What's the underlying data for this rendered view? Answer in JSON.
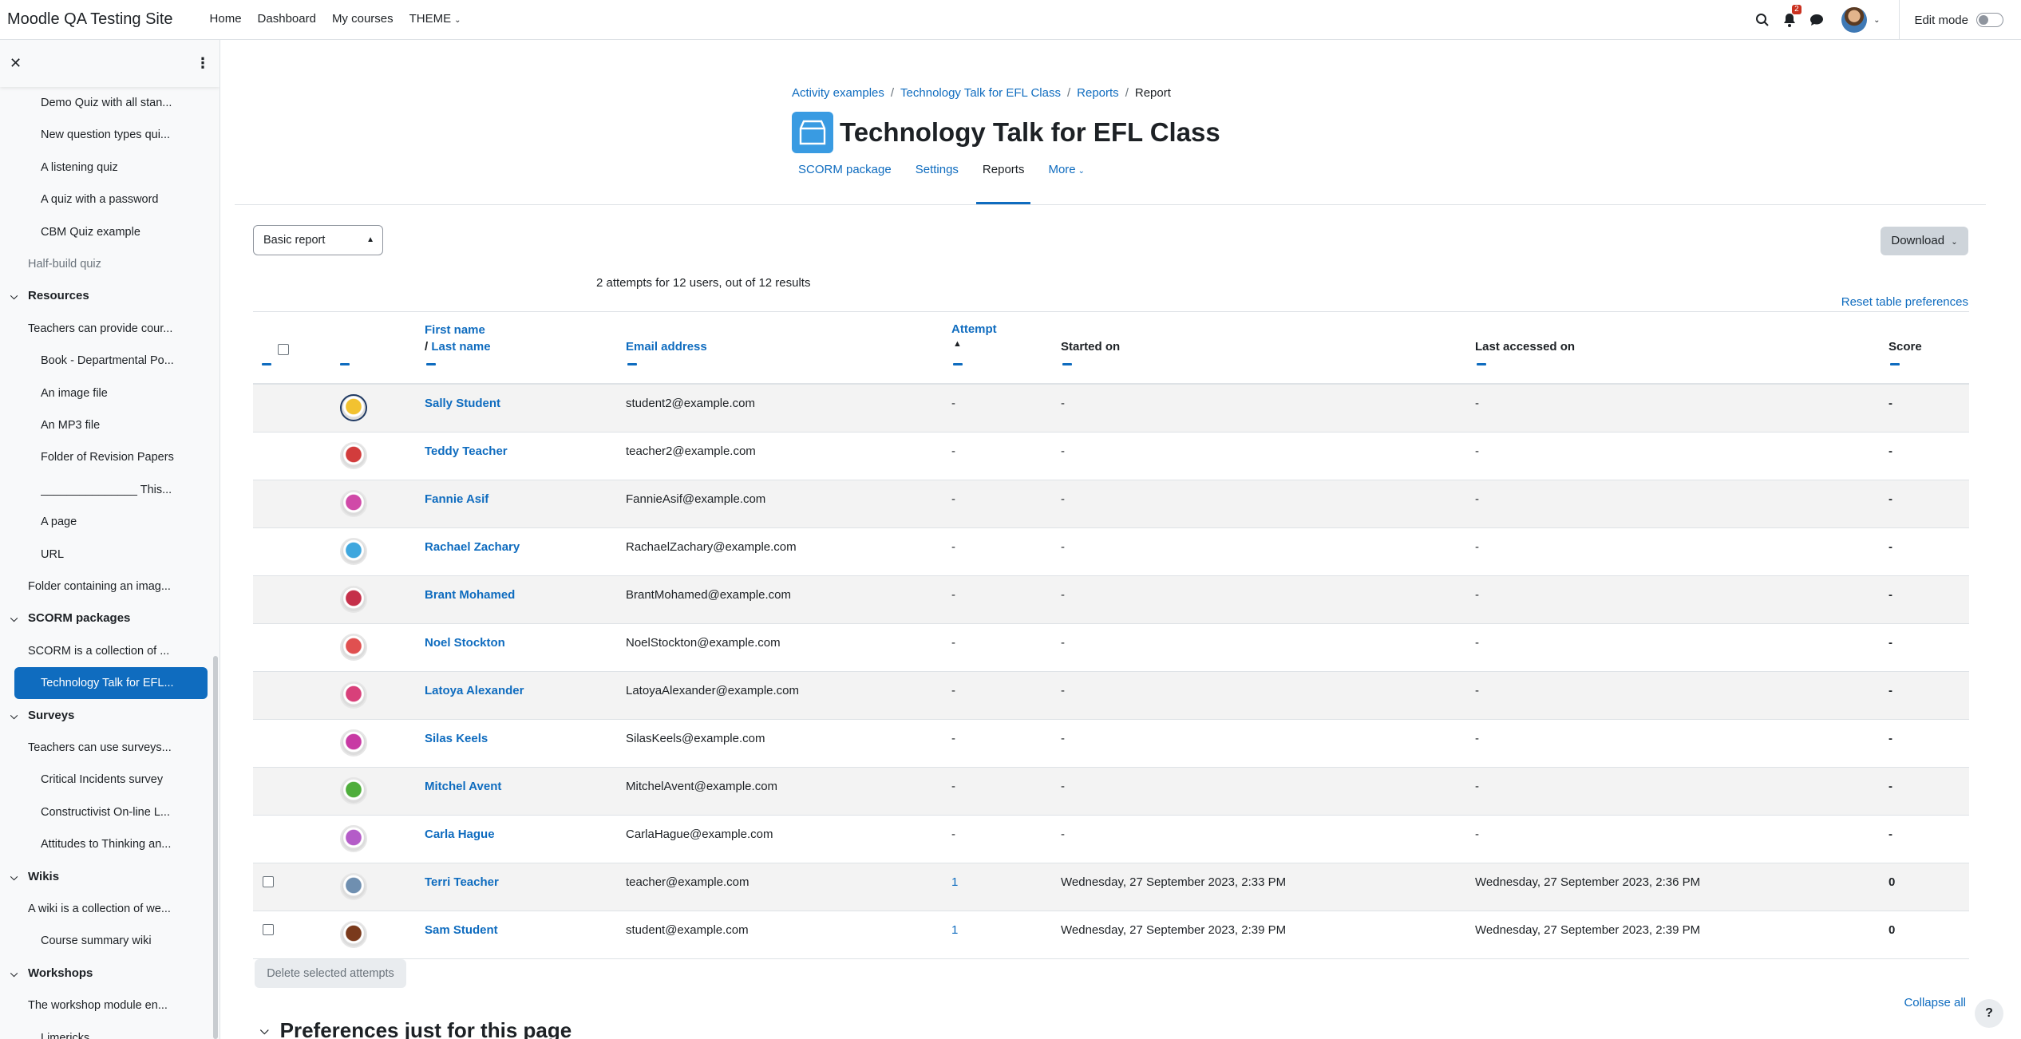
{
  "navbar": {
    "brand": "Moodle QA Testing Site",
    "items": [
      {
        "label": "Home"
      },
      {
        "label": "Dashboard"
      },
      {
        "label": "My courses"
      },
      {
        "label": "THEME"
      }
    ],
    "notifications_count": "2",
    "edit_mode_label": "Edit mode"
  },
  "drawer": {
    "items": [
      {
        "label": "Demo Quiz with all stan...",
        "level": "l2"
      },
      {
        "label": "New question types qui...",
        "level": "l2"
      },
      {
        "label": "A listening quiz",
        "level": "l2"
      },
      {
        "label": "A quiz with a password",
        "level": "l2"
      },
      {
        "label": "CBM Quiz example",
        "level": "l2"
      },
      {
        "label": "Half-build quiz",
        "level": "l1"
      },
      {
        "label": "Resources",
        "level": "section"
      },
      {
        "label": "Teachers can provide cour...",
        "level": "l1"
      },
      {
        "label": "Book - Departmental Po...",
        "level": "l2"
      },
      {
        "label": "An image file",
        "level": "l2"
      },
      {
        "label": "An MP3 file",
        "level": "l2"
      },
      {
        "label": "Folder of Revision Papers",
        "level": "l2"
      },
      {
        "label": "_______________ This...",
        "level": "l2"
      },
      {
        "label": "A page",
        "level": "l2"
      },
      {
        "label": "URL",
        "level": "l2"
      },
      {
        "label": "Folder containing an imag...",
        "level": "l1"
      },
      {
        "label": "SCORM packages",
        "level": "section"
      },
      {
        "label": "SCORM is a collection of ...",
        "level": "l1"
      },
      {
        "label": "Technology Talk for EFL...",
        "level": "active"
      },
      {
        "label": "Surveys",
        "level": "section"
      },
      {
        "label": "Teachers can use surveys...",
        "level": "l1"
      },
      {
        "label": "Critical Incidents survey",
        "level": "l2"
      },
      {
        "label": "Constructivist On-line L...",
        "level": "l2"
      },
      {
        "label": "Attitudes to Thinking an...",
        "level": "l2"
      },
      {
        "label": "Wikis",
        "level": "section"
      },
      {
        "label": "A wiki is a collection of we...",
        "level": "l1"
      },
      {
        "label": "Course summary wiki",
        "level": "l2"
      },
      {
        "label": "Workshops",
        "level": "section"
      },
      {
        "label": "The workshop module en...",
        "level": "l1"
      },
      {
        "label": "Limericks",
        "level": "l2"
      }
    ]
  },
  "breadcrumb": {
    "items": [
      "Activity examples",
      "Technology Talk for EFL Class",
      "Reports"
    ],
    "current": "Report"
  },
  "page": {
    "title": "Technology Talk for EFL Class",
    "tabs": [
      {
        "label": "SCORM package"
      },
      {
        "label": "Settings"
      },
      {
        "label": "Reports"
      },
      {
        "label": "More"
      }
    ],
    "report_select": "Basic report",
    "download_label": "Download",
    "results_text": "2 attempts for 12 users, out of 12 results",
    "reset_label": "Reset table preferences",
    "delete_label": "Delete selected attempts",
    "collapse_all": "Collapse all",
    "prefs_heading": "Preferences just for this page",
    "help": "?"
  },
  "table": {
    "headers": {
      "first_name": "First name",
      "slash": "/",
      "last_name": "Last name",
      "email": "Email address",
      "attempt": "Attempt",
      "started": "Started on",
      "last_accessed": "Last accessed on",
      "score": "Score"
    },
    "rows": [
      {
        "name": "Sally Student",
        "email": "student2@example.com",
        "attempt": "-",
        "started": "-",
        "last": "-",
        "score": "-",
        "checkbox": false,
        "color": "#f2c230"
      },
      {
        "name": "Teddy Teacher",
        "email": "teacher2@example.com",
        "attempt": "-",
        "started": "-",
        "last": "-",
        "score": "-",
        "checkbox": false,
        "color": "#d23c3c"
      },
      {
        "name": "Fannie Asif",
        "email": "FannieAsif@example.com",
        "attempt": "-",
        "started": "-",
        "last": "-",
        "score": "-",
        "checkbox": false,
        "color": "#d04aa8"
      },
      {
        "name": "Rachael Zachary",
        "email": "RachaelZachary@example.com",
        "attempt": "-",
        "started": "-",
        "last": "-",
        "score": "-",
        "checkbox": false,
        "color": "#3fa7de"
      },
      {
        "name": "Brant Mohamed",
        "email": "BrantMohamed@example.com",
        "attempt": "-",
        "started": "-",
        "last": "-",
        "score": "-",
        "checkbox": false,
        "color": "#c5304a"
      },
      {
        "name": "Noel Stockton",
        "email": "NoelStockton@example.com",
        "attempt": "-",
        "started": "-",
        "last": "-",
        "score": "-",
        "checkbox": false,
        "color": "#e05050"
      },
      {
        "name": "Latoya Alexander",
        "email": "LatoyaAlexander@example.com",
        "attempt": "-",
        "started": "-",
        "last": "-",
        "score": "-",
        "checkbox": false,
        "color": "#d8407a"
      },
      {
        "name": "Silas Keels",
        "email": "SilasKeels@example.com",
        "attempt": "-",
        "started": "-",
        "last": "-",
        "score": "-",
        "checkbox": false,
        "color": "#c83aa4"
      },
      {
        "name": "Mitchel Avent",
        "email": "MitchelAvent@example.com",
        "attempt": "-",
        "started": "-",
        "last": "-",
        "score": "-",
        "checkbox": false,
        "color": "#4fae3c"
      },
      {
        "name": "Carla Hague",
        "email": "CarlaHague@example.com",
        "attempt": "-",
        "started": "-",
        "last": "-",
        "score": "-",
        "checkbox": false,
        "color": "#b45cc8"
      },
      {
        "name": "Terri Teacher",
        "email": "teacher@example.com",
        "attempt": "1",
        "started": "Wednesday, 27 September 2023, 2:33 PM",
        "last": "Wednesday, 27 September 2023, 2:36 PM",
        "score": "0",
        "checkbox": true,
        "color": "#6f8fb0"
      },
      {
        "name": "Sam Student",
        "email": "student@example.com",
        "attempt": "1",
        "started": "Wednesday, 27 September 2023, 2:39 PM",
        "last": "Wednesday, 27 September 2023, 2:39 PM",
        "score": "0",
        "checkbox": true,
        "color": "#7a3a1c"
      }
    ]
  },
  "colors": {
    "accent": "#0f6cbf",
    "active_bg": "#0f6cbf",
    "scorm_icon": "#399be2"
  }
}
